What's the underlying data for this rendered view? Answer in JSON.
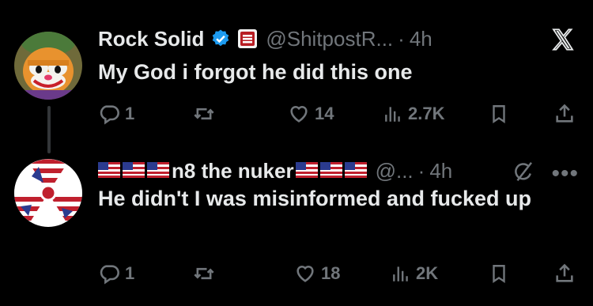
{
  "tweets": [
    {
      "name": "Rock Solid",
      "handle": "@ShitpostR...",
      "separator": "·",
      "time": "4h",
      "text": "My God i forgot he did this one",
      "replies": "1",
      "retweets": "",
      "likes": "14",
      "views": "2.7K"
    },
    {
      "name": "n8 the nuker",
      "handle": "@...",
      "separator": "·",
      "time": "4h",
      "text": "He didn't I was misinformed and fucked up",
      "replies": "1",
      "retweets": "",
      "likes": "18",
      "views": "2K"
    }
  ],
  "colors": {
    "background": "#000000",
    "text": "#e7e9ea",
    "muted": "#71767b",
    "verified": "#1d9bf0",
    "thread_line": "#333639"
  },
  "icons": [
    "verified-badge-icon",
    "affiliate-badge-icon",
    "x-logo-icon",
    "reply-icon",
    "retweet-icon",
    "like-icon",
    "views-icon",
    "bookmark-icon",
    "share-icon",
    "grok-icon",
    "more-icon",
    "us-flag-icon",
    "radiation-symbol-icon"
  ]
}
